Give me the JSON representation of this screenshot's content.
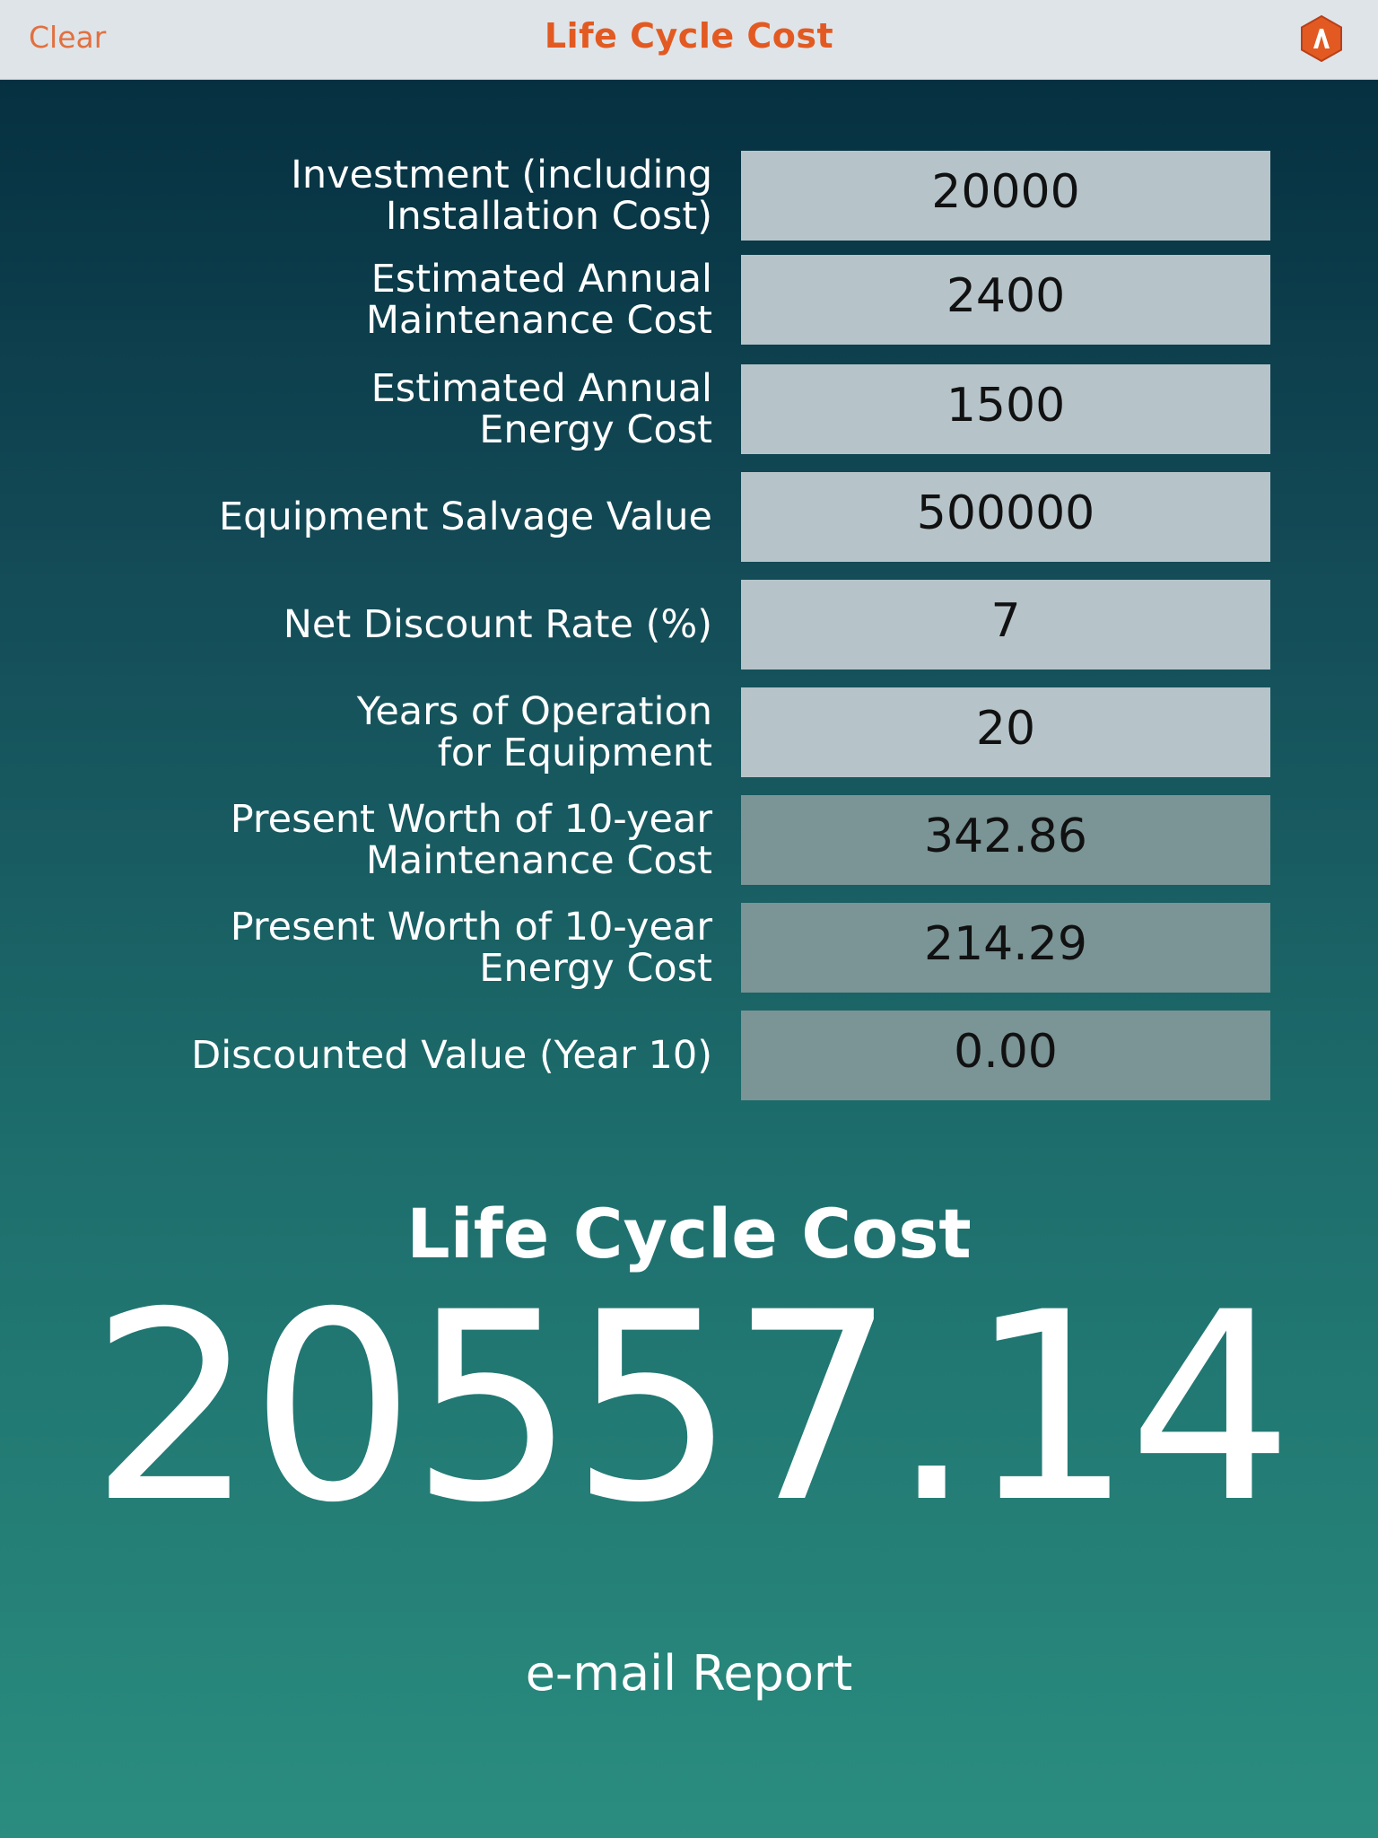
{
  "header": {
    "clear_label": "Clear",
    "title": "Life Cycle Cost",
    "logo_icon": "app-logo-icon",
    "accent_color": "#e25a22"
  },
  "fields": [
    {
      "label": "Investment (including\nInstallation Cost)",
      "value": "20000",
      "editable": true
    },
    {
      "label": "Estimated Annual\nMaintenance Cost",
      "value": "2400",
      "editable": true
    },
    {
      "label": "Estimated Annual\nEnergy Cost",
      "value": "1500",
      "editable": true
    },
    {
      "label": "Equipment Salvage Value",
      "value": "500000",
      "editable": true
    },
    {
      "label": "Net Discount Rate (%)",
      "value": "7",
      "editable": true
    },
    {
      "label": "Years of Operation\nfor Equipment",
      "value": "20",
      "editable": true
    },
    {
      "label": "Present Worth of 10-year\nMaintenance Cost",
      "value": "342.86",
      "editable": false
    },
    {
      "label": "Present Worth of 10-year\nEnergy Cost",
      "value": "214.29",
      "editable": false
    },
    {
      "label": "Discounted Value (Year 10)",
      "value": "0.00",
      "editable": false
    }
  ],
  "result": {
    "label": "Life Cycle Cost",
    "value": "20557.14"
  },
  "actions": {
    "email_label": "e-mail Report"
  }
}
